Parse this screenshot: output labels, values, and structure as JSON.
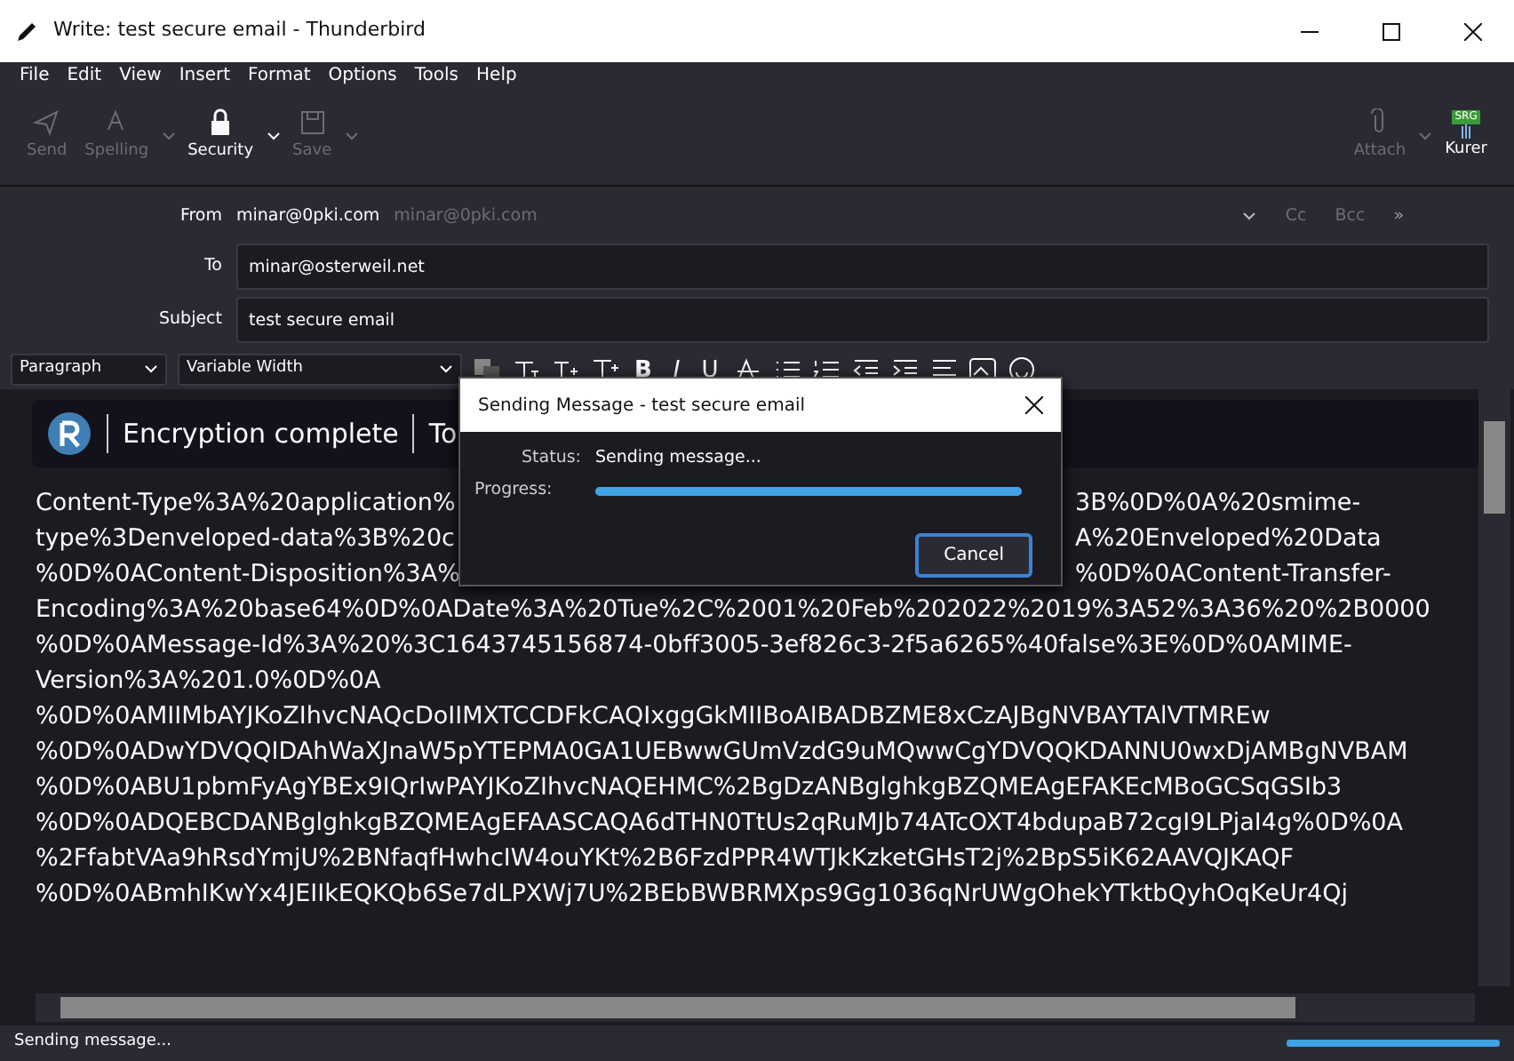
{
  "window": {
    "title": "Write: test secure email - Thunderbird"
  },
  "menu": [
    "File",
    "Edit",
    "View",
    "Insert",
    "Format",
    "Options",
    "Tools",
    "Help"
  ],
  "toolbar": [
    {
      "label": "Send",
      "kind": "send",
      "disabled": true,
      "dropdown": false
    },
    {
      "label": "Spelling",
      "kind": "spelling",
      "disabled": true,
      "dropdown": true
    },
    {
      "label": "Security",
      "kind": "security",
      "disabled": false,
      "dropdown": true
    },
    {
      "label": "Save",
      "kind": "save",
      "disabled": true,
      "dropdown": true
    }
  ],
  "toolbar_right": [
    {
      "label": "Attach",
      "kind": "attach",
      "disabled": true,
      "dropdown": true
    },
    {
      "label": "Kurer",
      "kind": "kurer",
      "disabled": false,
      "dropdown": false,
      "badge": "SRG"
    }
  ],
  "from": {
    "label": "From",
    "address": "minar@0pki.com",
    "identity": "minar@0pki.com",
    "cc": "Cc",
    "bcc": "Bcc",
    "more": "»"
  },
  "to": {
    "label": "To",
    "value": "minar@osterweil.net"
  },
  "subject": {
    "label": "Subject",
    "value": "test secure email"
  },
  "format_bar": {
    "paragraph": "Paragraph",
    "font": "Variable Width",
    "text_buttons": [
      {
        "label": "B",
        "kind": "bold"
      },
      {
        "label": "I",
        "kind": "italic"
      },
      {
        "label": "U",
        "kind": "underline"
      }
    ]
  },
  "banner": {
    "status": "Encryption complete",
    "to": "To"
  },
  "body_lines": [
    {
      "left": "Content-Type%3A%20application%",
      "right": "3B%0D%0A%20smime-"
    },
    {
      "left": "type%3Denveloped-data%3B%20c",
      "right": "A%20Enveloped%20Data"
    },
    {
      "left": "%0D%0AContent-Disposition%3A%",
      "right": "%0D%0AContent-Transfer-"
    },
    {
      "left": "Encoding%3A%20base64%0D%0ADate%3A%20Tue%2C%2001%20Feb%202022%2019%3A52%3A36%20%2B0000"
    },
    {
      "left": "%0D%0AMessage-Id%3A%20%3C1643745156874-0bff3005-3ef826c3-2f5a6265%40false%3E%0D%0AMIME-"
    },
    {
      "left": "Version%3A%201.0%0D%0A"
    },
    {
      "left": "%0D%0AMIIMbAYJKoZIhvcNAQcDoIIMXTCCDFkCAQIxggGkMIIBoAIBADBZME8xCzAJBgNVBAYTAlVTMREw"
    },
    {
      "left": "%0D%0ADwYDVQQIDAhWaXJnaW5pYTEPMA0GA1UEBwwGUmVzdG9uMQwwCgYDVQQKDANNU0wxDjAMBgNVBAM"
    },
    {
      "left": "%0D%0ABU1pbmFyAgYBEx9IQrIwPAYJKoZIhvcNAQEHMC%2BgDzANBglghkgBZQMEAgEFAKEcMBoGCSqGSIb3"
    },
    {
      "left": "%0D%0ADQEBCDANBglghkgBZQMEAgEFAASCAQA6dTHN0TtUs2qRuMJb74ATcOXT4bdupaB72cgI9LPjaI4g%0D%0A"
    },
    {
      "left": "%2FfabtVAa9hRsdYmjU%2BNfaqfHwhcIW4ouYKt%2B6FzdPPR4WTJkKzketGHsT2j%2BpS5iK62AAVQJKAQF"
    },
    {
      "left": "%0D%0ABmhIKwYx4JEIIkEQKQb6Se7dLPXWj7U%2BEbBWBRMXps9Gg1036qNrUWgOhekYTktbQyhOqKeUr4Qj"
    }
  ],
  "dialog": {
    "title": "Sending Message - test secure email",
    "status_label": "Status:",
    "status": "Sending message...",
    "progress_label": "Progress:",
    "level": 1.0,
    "button": "Cancel"
  },
  "status_bar": {
    "text": "Sending message...",
    "level": 1.0
  }
}
